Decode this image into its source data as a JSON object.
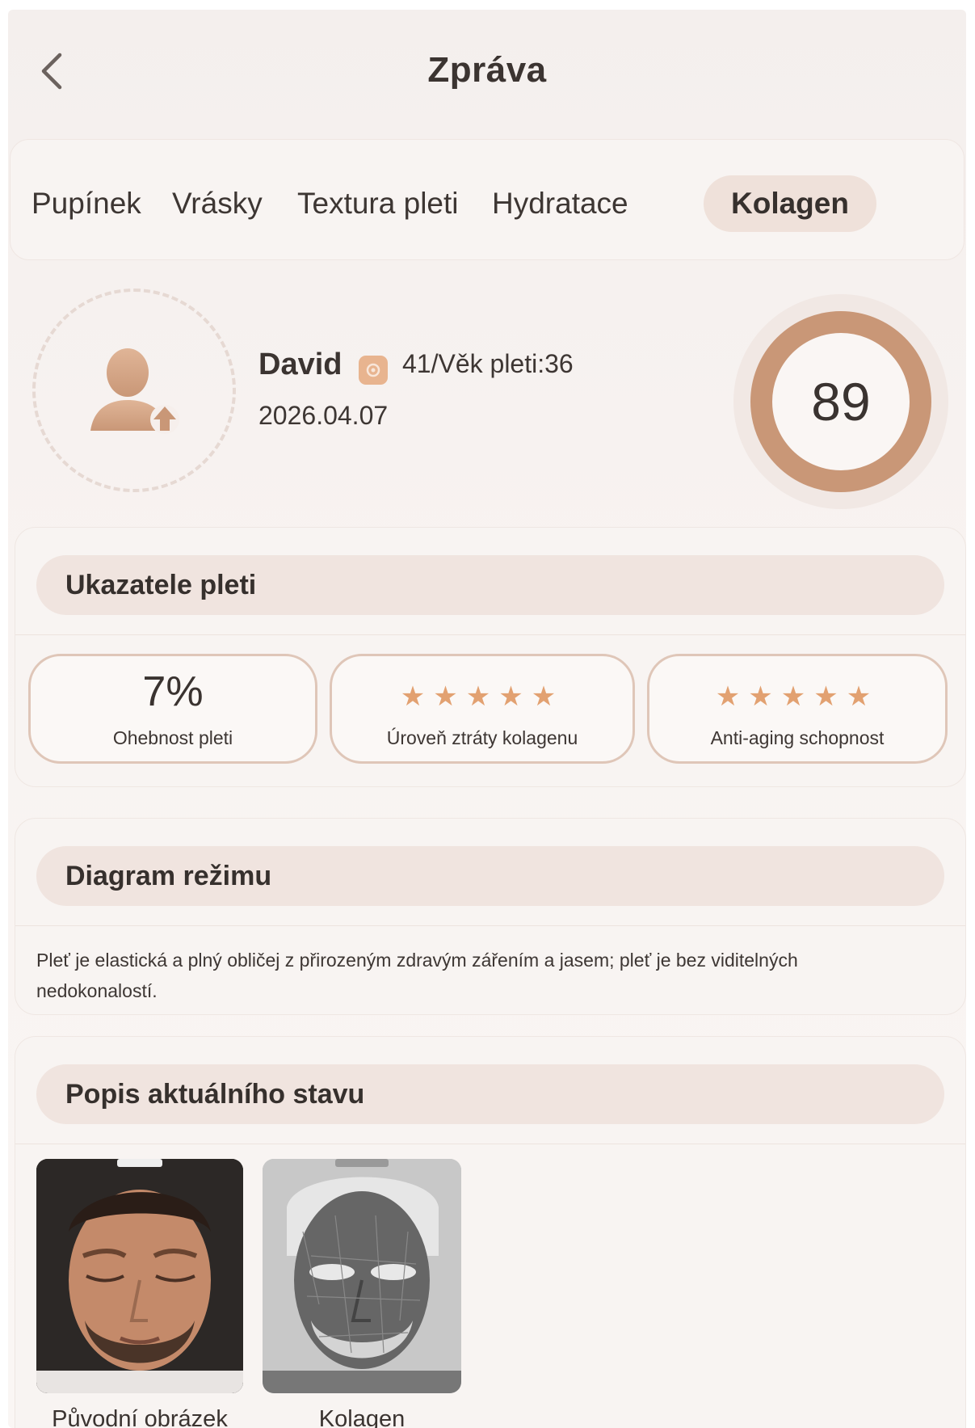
{
  "header": {
    "title": "Zpráva"
  },
  "tabs": [
    {
      "label": "Pupínek",
      "active": false
    },
    {
      "label": "Vrásky",
      "active": false
    },
    {
      "label": "Textura pleti",
      "active": false
    },
    {
      "label": "Hydratace",
      "active": false
    },
    {
      "label": "Kolagen",
      "active": true
    }
  ],
  "profile": {
    "name": "David",
    "age_text": "41/Věk pleti:36",
    "date": "2026.04.07",
    "score": "89"
  },
  "indicators": {
    "title": "Ukazatele pleti",
    "items": [
      {
        "value": "7%",
        "label": "Ohebnost pleti"
      },
      {
        "stars": 5,
        "stars_text": "★★★★★",
        "label": "Úroveň ztráty kolagenu"
      },
      {
        "stars": 5,
        "stars_text": "★★★★★",
        "label": "Anti-aging schopnost"
      }
    ]
  },
  "diagram": {
    "title": "Diagram režimu",
    "text": "Pleť je elastická a plný obličej z přirozeným zdravým zářením a jasem; pleť je bez viditelných nedokonalostí."
  },
  "status": {
    "title": "Popis aktuálního stavu",
    "images": [
      {
        "label": "Původní obrázek"
      },
      {
        "label": "Kolagen"
      }
    ]
  },
  "colors": {
    "accent": "#c99777",
    "star": "#e2a171",
    "active_tab_bg": "#efe1da"
  },
  "icons": [
    "back-chevron-icon",
    "user-upload-icon",
    "gender-icon",
    "star-icon"
  ]
}
